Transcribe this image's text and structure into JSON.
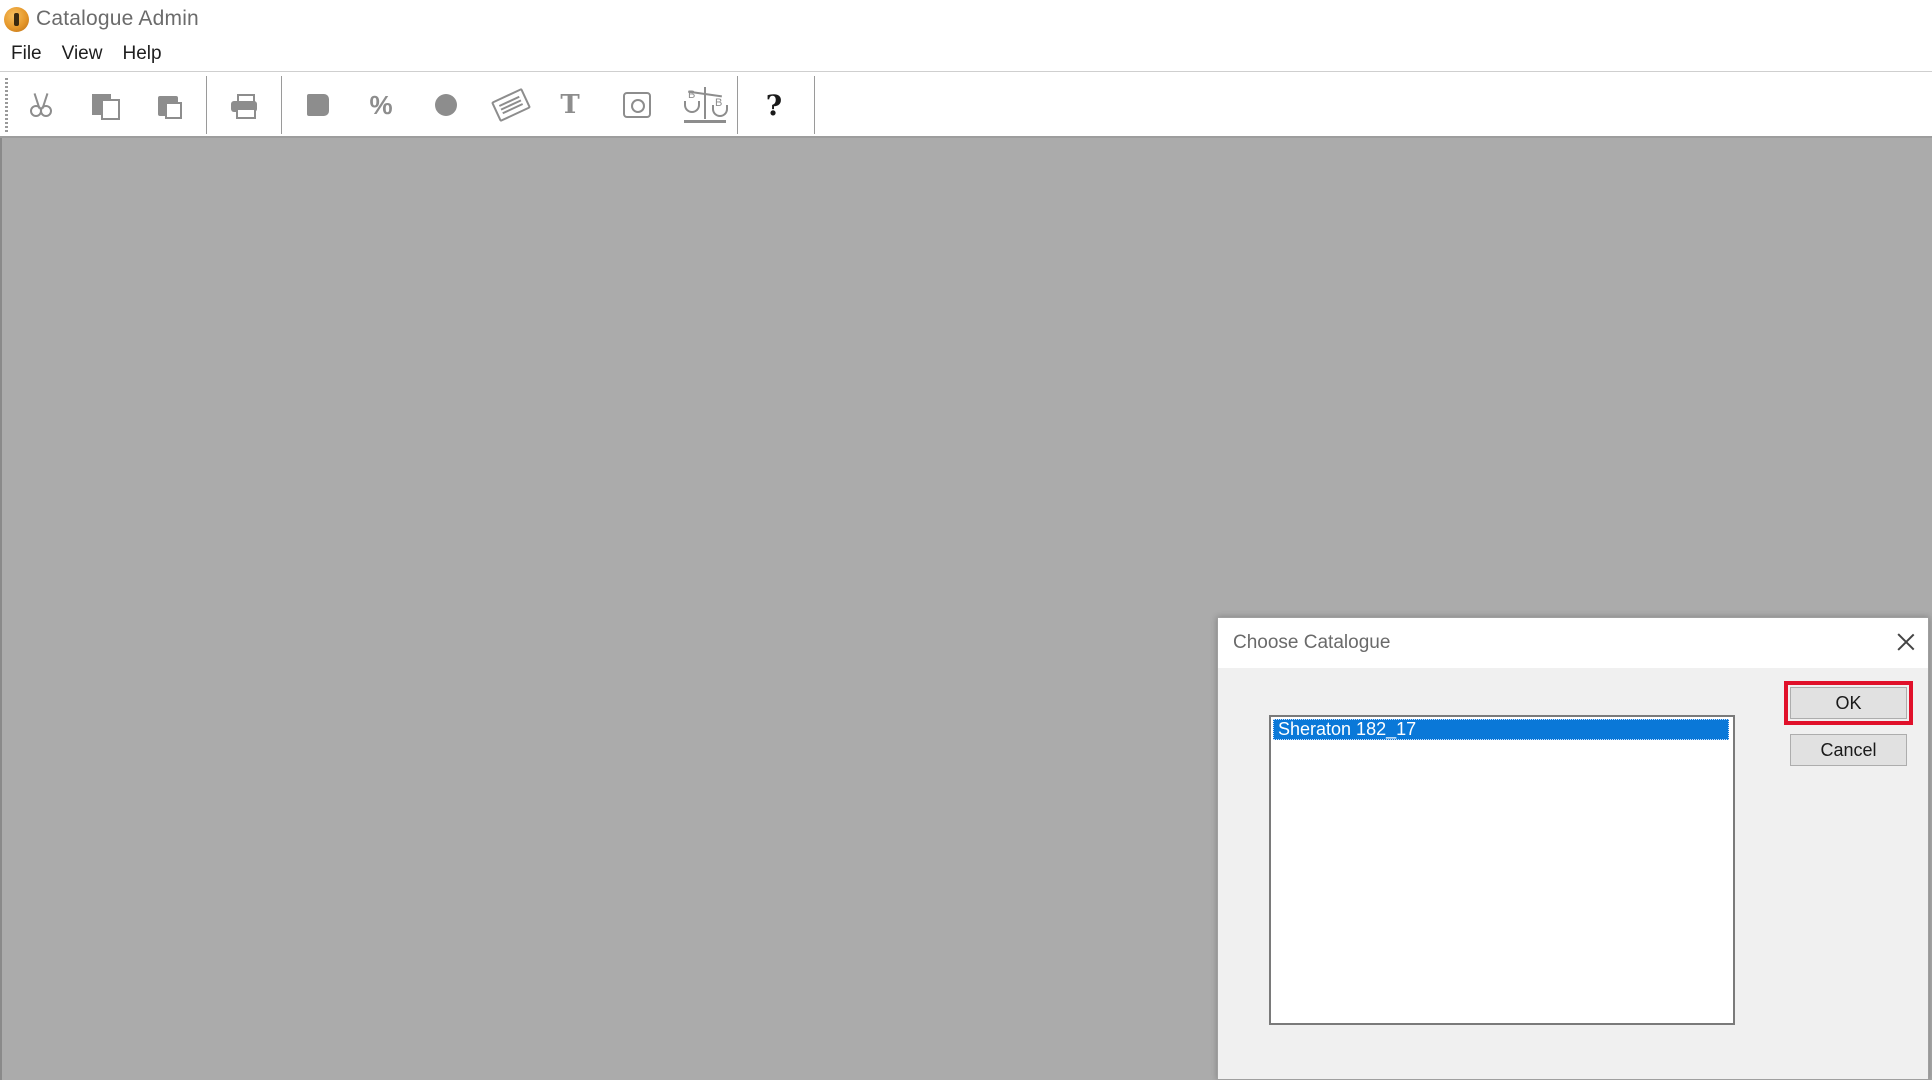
{
  "window": {
    "title": "Catalogue Admin",
    "icon": "app-logo-icon"
  },
  "menu": {
    "items": [
      "File",
      "View",
      "Help"
    ]
  },
  "toolbar": {
    "buttons": [
      {
        "name": "cut-icon"
      },
      {
        "name": "copy-icon"
      },
      {
        "name": "paste-icon"
      },
      {
        "name": "print-icon"
      },
      {
        "name": "book-icon"
      },
      {
        "name": "percent-icon",
        "glyph": "%"
      },
      {
        "name": "disc-icon"
      },
      {
        "name": "ticket-icon"
      },
      {
        "name": "text-icon",
        "glyph": "T"
      },
      {
        "name": "camera-icon"
      },
      {
        "name": "scale-icon",
        "left_mark": "B",
        "right_mark": "B"
      },
      {
        "name": "help-icon",
        "glyph": "?"
      }
    ]
  },
  "dialog": {
    "title": "Choose Catalogue",
    "list": {
      "items": [
        "Sheraton 182_17"
      ],
      "selected_index": 0
    },
    "ok_label": "OK",
    "cancel_label": "Cancel",
    "highlight_color": "#e0102a"
  },
  "colors": {
    "mdi_background": "#ababab",
    "selection": "#0a78d8"
  }
}
